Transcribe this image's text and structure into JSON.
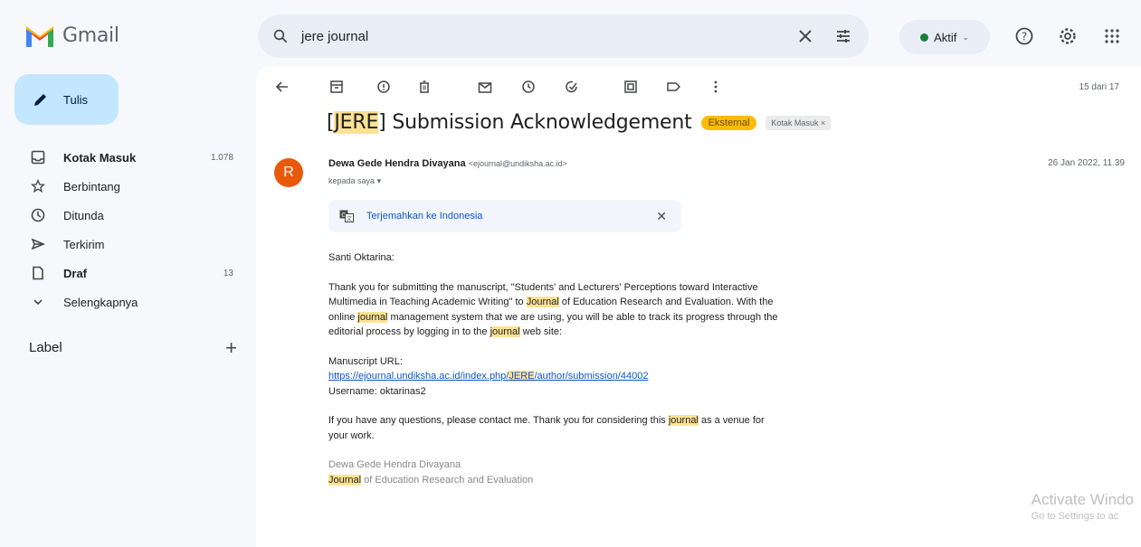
{
  "app": {
    "name": "Gmail"
  },
  "search": {
    "query": "jere journal"
  },
  "status": {
    "label": "Aktif"
  },
  "compose": {
    "label": "Tulis"
  },
  "nav": {
    "items": [
      {
        "label": "Kotak Masuk",
        "count": "1.078"
      },
      {
        "label": "Berbintang",
        "count": ""
      },
      {
        "label": "Ditunda",
        "count": ""
      },
      {
        "label": "Terkirim",
        "count": ""
      },
      {
        "label": "Draf",
        "count": "13"
      },
      {
        "label": "Selengkapnya",
        "count": ""
      }
    ],
    "label_heading": "Label"
  },
  "toolbar": {
    "page_count": "15 dari 17"
  },
  "email": {
    "subject_tag": "JERE",
    "subject_text": "Submission Acknowledgement",
    "badge_external": "Eksternal",
    "badge_inbox": "Kotak Masuk ×",
    "sender_initial": "R",
    "sender_name": "Dewa Gede Hendra Divayana",
    "sender_email": "<ejournal@undiksha.ac.id>",
    "to": "kepada saya",
    "date": "26 Jan 2022, 11.39",
    "translate_label": "Terjemahkan ke Indonesia",
    "greeting": "Santi Oktarina:",
    "p1_a": "Thank you for submitting the manuscript, \"Students' and Lecturers' Perceptions toward Interactive Multimedia in Teaching Academic Writing\" to ",
    "p1_hl1": "Journal",
    "p1_b": " of Education Research and Evaluation. With the online ",
    "p1_hl2": "journal",
    "p1_c": " management system that we are using, you will be able to track its progress through the editorial process by logging in to the ",
    "p1_hl3": "journal",
    "p1_d": " web site:",
    "url_label": "Manuscript URL:",
    "url_a": "https://ejournal.undiksha.ac.id/index.php/",
    "url_hl": "JERE",
    "url_b": "/author/submission/44002",
    "username": "Username: oktarinas2",
    "p3_a": "If you have any questions, please contact me. Thank you for considering this ",
    "p3_hl": "journal",
    "p3_b": " as a venue for your work.",
    "sig_name": "Dewa Gede Hendra Divayana",
    "sig_hl": "Journal",
    "sig_rest": " of Education Research and Evaluation"
  },
  "watermark": {
    "line1": "Activate Windo",
    "line2": "Go to Settings to ac"
  },
  "colors": {
    "compose_bg": "#c2e7ff",
    "avatar": "#e8590c",
    "highlight": "#fde293",
    "external_badge": "#fbbc04"
  }
}
